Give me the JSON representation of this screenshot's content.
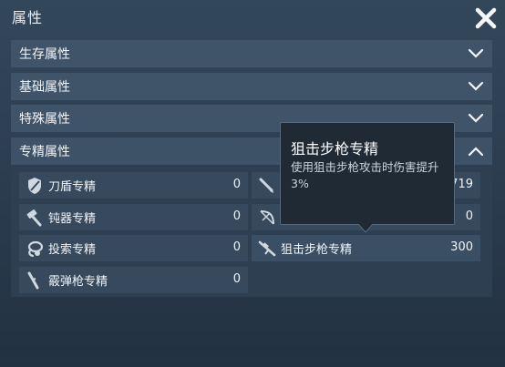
{
  "window": {
    "title": "属性"
  },
  "sections": [
    {
      "label": "生存属性"
    },
    {
      "label": "基础属性"
    },
    {
      "label": "特殊属性"
    },
    {
      "label": "专精属性"
    }
  ],
  "skills": [
    {
      "label": "刀盾专精",
      "value": "0",
      "icon": "shield-blade-icon"
    },
    {
      "label": "",
      "value": "719",
      "icon": "knife-icon"
    },
    {
      "label": "钝器专精",
      "value": "0",
      "icon": "hammer-icon"
    },
    {
      "label": "",
      "value": "0",
      "icon": "bow-icon"
    },
    {
      "label": "投索专精",
      "value": "0",
      "icon": "lasso-icon"
    },
    {
      "label": "狙击步枪专精",
      "value": "300",
      "icon": "sniper-rifle-icon"
    },
    {
      "label": "霰弹枪专精",
      "value": "0",
      "icon": "shotgun-icon"
    }
  ],
  "tooltip": {
    "title": "狙击步枪专精",
    "description": "使用狙击步枪攻击时伤害提升3%"
  },
  "colors": {
    "bar": "#3f5468",
    "cell": "#36495d",
    "tooltip_bg": "#1f2a35"
  }
}
